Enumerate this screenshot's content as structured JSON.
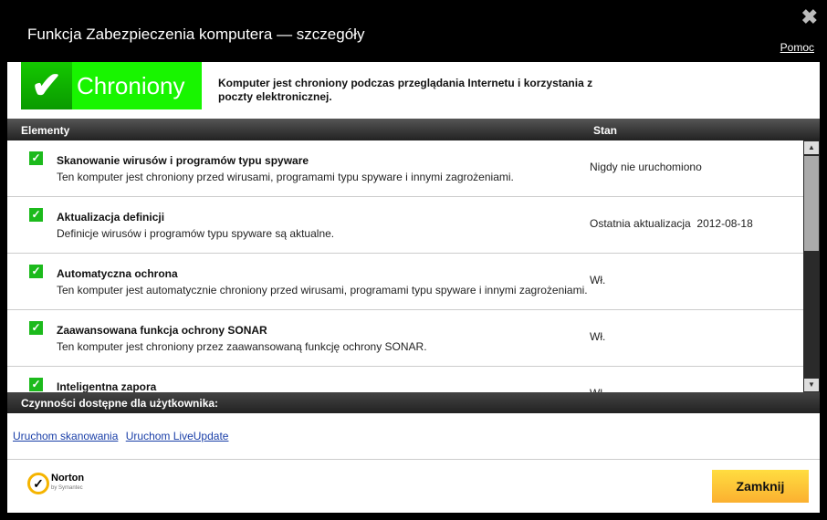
{
  "window": {
    "title": "Funkcja Zabezpieczenia komputera — szczegóły",
    "help": "Pomoc",
    "close_icon": "close-icon"
  },
  "status": {
    "label": "Chroniony",
    "description": "Komputer jest chroniony podczas przeglądania Internetu i korzystania z poczty elektronicznej.",
    "color": "#18f500"
  },
  "table": {
    "col_elements": "Elementy",
    "col_state": "Stan",
    "rows": [
      {
        "title": "Skanowanie wirusów i programów typu spyware",
        "desc": "Ten komputer jest chroniony przed wirusami, programami typu spyware i innymi zagrożeniami.",
        "state": "Nigdy nie uruchomiono"
      },
      {
        "title": "Aktualizacja definicji",
        "desc": "Definicje wirusów i programów typu spyware są aktualne.",
        "state": "Ostatnia aktualizacja  2012-08-18"
      },
      {
        "title": "Automatyczna ochrona",
        "desc": "Ten komputer jest automatycznie chroniony przed wirusami, programami typu spyware i innymi zagrożeniami.",
        "state": "Wł."
      },
      {
        "title": "Zaawansowana funkcja ochrony SONAR",
        "desc": "Ten komputer jest chroniony przez zaawansowaną funkcję ochrony SONAR.",
        "state": "Wł."
      },
      {
        "title": "Inteligentna zapora",
        "desc": "",
        "state": "Wł."
      }
    ]
  },
  "actions": {
    "header": "Czynności dostępne dla użytkownika:",
    "links": [
      "Uruchom skanowania",
      "Uruchom LiveUpdate"
    ]
  },
  "footer": {
    "logo": "Norton",
    "logo_sub": "by Symantec",
    "close": "Zamknij"
  }
}
